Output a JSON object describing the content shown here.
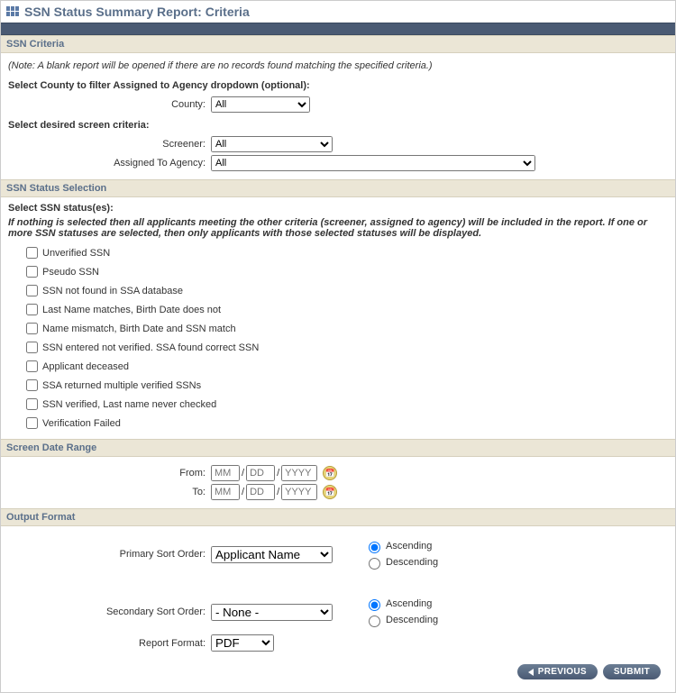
{
  "page_title": "SSN Status Summary Report: Criteria",
  "sections": {
    "ssn_criteria": {
      "header": "SSN Criteria",
      "note": "(Note: A blank report will be opened if there are no records found matching the specified criteria.)",
      "county_filter_label": "Select County to filter Assigned to Agency dropdown (optional):",
      "county_label": "County:",
      "county_value": "All",
      "screen_criteria_label": "Select desired screen criteria:",
      "screener_label": "Screener:",
      "screener_value": "All",
      "assigned_label": "Assigned To Agency:",
      "assigned_value": "All"
    },
    "ssn_status": {
      "header": "SSN Status Selection",
      "select_label": "Select SSN status(es):",
      "hint": "If nothing is selected then all applicants meeting the other criteria (screener, assigned to agency) will be included in the report. If one or more SSN statuses are selected, then only applicants with those selected statuses will be displayed.",
      "options": [
        "Unverified SSN",
        "Pseudo SSN",
        "SSN not found in SSA database",
        "Last Name matches, Birth Date does not",
        "Name mismatch, Birth Date and SSN match",
        "SSN entered not verified. SSA found correct SSN",
        "Applicant deceased",
        "SSA returned multiple verified SSNs",
        "SSN verified, Last name never checked",
        "Verification Failed"
      ]
    },
    "date_range": {
      "header": "Screen Date Range",
      "from_label": "From:",
      "to_label": "To:",
      "mm_ph": "MM",
      "dd_ph": "DD",
      "yyyy_ph": "YYYY"
    },
    "output": {
      "header": "Output Format",
      "primary_label": "Primary Sort Order:",
      "primary_value": "Applicant Name",
      "secondary_label": "Secondary Sort Order:",
      "secondary_value": "- None -",
      "report_format_label": "Report Format:",
      "report_format_value": "PDF",
      "asc_label": "Ascending",
      "desc_label": "Descending"
    }
  },
  "buttons": {
    "previous": "PREVIOUS",
    "submit": "SUBMIT"
  }
}
